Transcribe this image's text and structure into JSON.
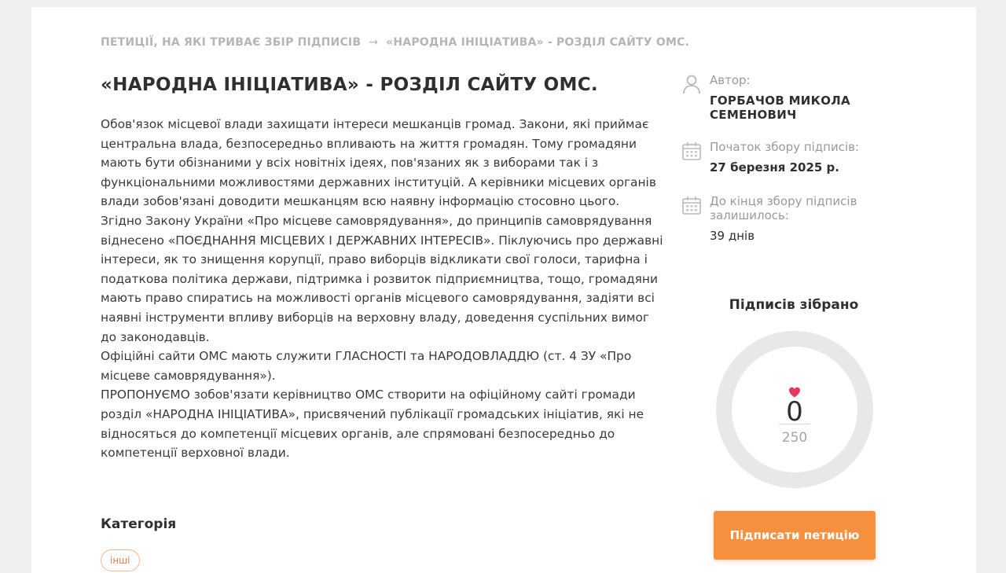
{
  "breadcrumb": {
    "parent": "ПЕТИЦІЇ, НА ЯКІ ТРИВАЄ ЗБІР ПІДПИСІВ",
    "separator": "→",
    "current": "«НАРОДНА ІНІЦІАТИВА» - РОЗДІЛ САЙТУ ОМС."
  },
  "petition": {
    "title": "«НАРОДНА ІНІЦІАТИВА» - РОЗДІЛ САЙТУ ОМС.",
    "paragraphs": [
      "Обов'язок місцевої влади захищати інтереси мешканців громад. Закони, які приймає центральна влада, безпосередньо впливають на життя громадян. Тому громадяни мають бути обізнаними у всіх новітніх ідеях, пов'язаних як з виборами так і з функціональними можливостями державних інституцій. А керівники місцевих органів влади зобов'язані доводити мешканцям всю наявну інформацію стосовно цього.",
      "Згідно Закону України «Про місцеве самоврядування», до принципів самоврядування віднесено «ПОЄДНАННЯ МІСЦЕВИХ І ДЕРЖАВНИХ ІНТЕРЕСІВ». Піклуючись про державні інтереси, як то знищення корупції, право виборців відкликати свої голоси, тарифна і податкова політика держави, підтримка і розвиток підприємництва, тощо, громадяни мають право спиратись на можливості органів місцевого самоврядування, задіяти всі наявні інструменти впливу виборців на верховну владу, доведення суспільних вимог до законодавців.",
      "Офіційні сайти ОМС мають служити ГЛАСНОСТІ та НАРОДОВЛАДДЮ (ст. 4 ЗУ «Про місцеве самоврядування»).",
      "ПРОПОНУЄМО зобов'язати керівництво ОМС створити на офіційному сайті громади розділ «НАРОДНА ІНІЦІАТИВА», присвячений публікації громадських ініціатив, які не відносяться до компетенції місцевих органів, але спрямовані безпосередньо до компетенції верховної влади."
    ],
    "category_title": "Категорія",
    "category_tag": "інші"
  },
  "sidebar": {
    "author_label": "Автор:",
    "author_name": "ГОРБАЧОВ МИКОЛА СЕМЕНОВИЧ",
    "start_label": "Початок збору підписів:",
    "start_date": "27 березня 2025 р.",
    "end_label": "До кінця збору підписів залишилось:",
    "days_left": "39 днів",
    "icons": [
      "user-icon",
      "calendar-icon",
      "calendar-icon"
    ]
  },
  "signatures": {
    "title": "Підписів зібрано",
    "collected": "0",
    "goal": "250",
    "progress": 0,
    "ring_color": "#e8e8e8",
    "heart_color": "#e8395a"
  },
  "actions": {
    "sign_button": "Підписати петицію",
    "button_color": "#f5913e"
  }
}
